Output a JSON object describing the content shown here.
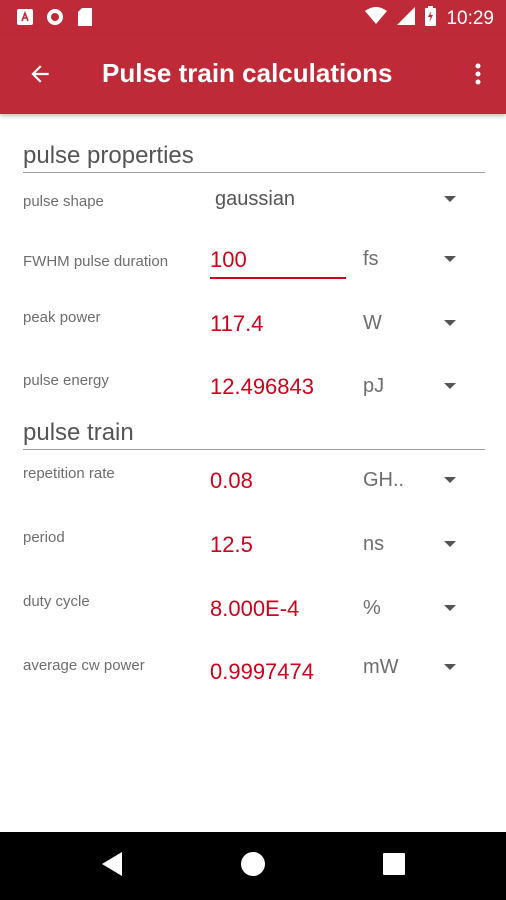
{
  "status_bar": {
    "time": "10:29",
    "left_icons": [
      "app-a-icon",
      "record-icon",
      "sd-card-icon"
    ],
    "right_icons": [
      "wifi-icon",
      "signal-icon",
      "battery-charging-icon"
    ]
  },
  "app_bar": {
    "title": "Pulse train calculations",
    "back_icon": "back-arrow-icon",
    "menu_icon": "overflow-menu-icon"
  },
  "sections": {
    "pulse_properties": {
      "header": "pulse properties",
      "pulse_shape": {
        "label": "pulse shape",
        "value": "gaussian"
      },
      "fwhm": {
        "label": "FWHM pulse duration",
        "value": "100",
        "unit": "fs"
      },
      "peak_power": {
        "label": "peak power",
        "value": "117.4",
        "unit": "W"
      },
      "pulse_energy": {
        "label": "pulse energy",
        "value": "12.496843",
        "unit": "pJ"
      }
    },
    "pulse_train": {
      "header": "pulse train",
      "repetition_rate": {
        "label": "repetition rate",
        "value": "0.08",
        "unit": "GH.."
      },
      "period": {
        "label": "period",
        "value": "12.5",
        "unit": "ns"
      },
      "duty_cycle": {
        "label": "duty cycle",
        "value": "8.000E-4",
        "unit": "%"
      },
      "avg_power": {
        "label": "average cw power",
        "value": "0.9997474",
        "unit": "mW"
      }
    }
  },
  "colors": {
    "primary": "#bf2a38",
    "value_red": "#d0021b",
    "label_gray": "#6d6d6d"
  },
  "nav_bar": {
    "icons": [
      "nav-back-icon",
      "nav-home-icon",
      "nav-recents-icon"
    ]
  }
}
